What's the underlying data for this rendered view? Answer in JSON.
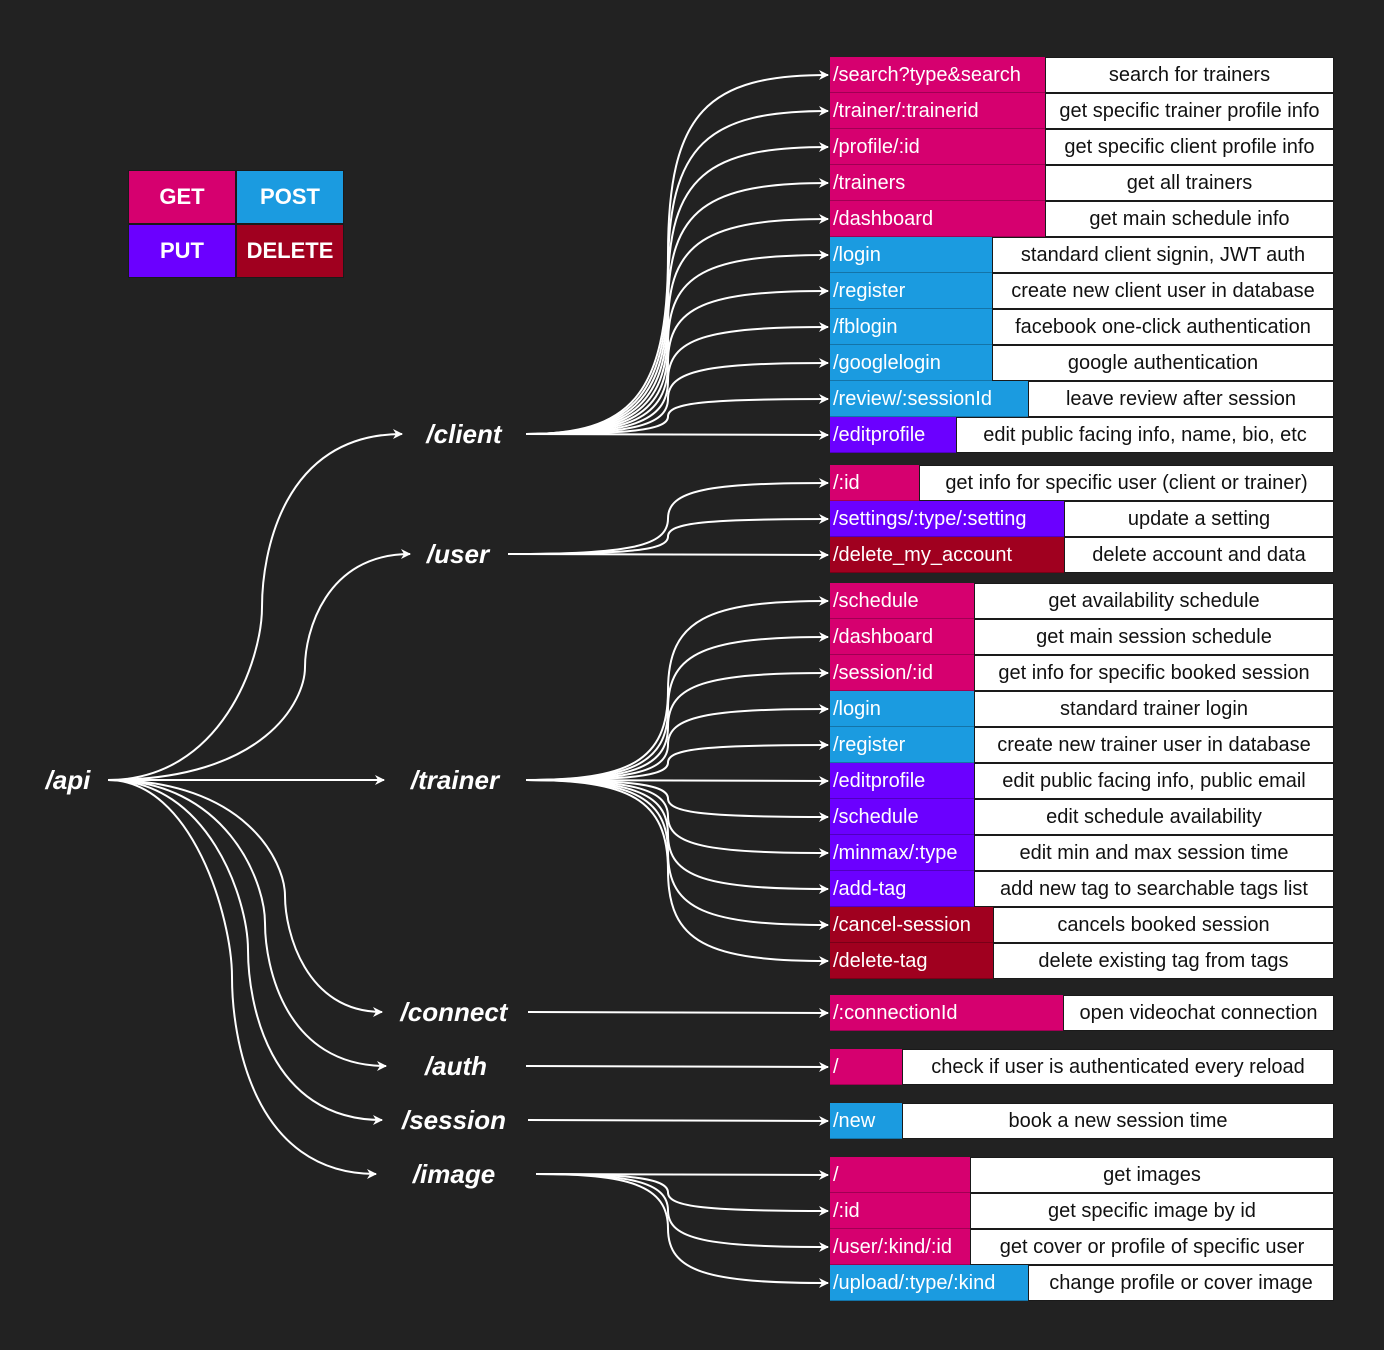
{
  "colors": {
    "GET": "#d6006f",
    "POST": "#1b9be0",
    "PUT": "#6b00ff",
    "DELETE": "#a0001f",
    "background": "#222222",
    "wire": "#ffffff"
  },
  "legend": [
    {
      "method": "GET",
      "label": "GET"
    },
    {
      "method": "POST",
      "label": "POST"
    },
    {
      "method": "PUT",
      "label": "PUT"
    },
    {
      "method": "DELETE",
      "label": "DELETE"
    }
  ],
  "root": {
    "label": "/api"
  },
  "groups": [
    {
      "name": "client",
      "label": "/client",
      "routes": [
        {
          "path": "/search?type&search",
          "method": "GET",
          "desc": "search for trainers"
        },
        {
          "path": "/trainer/:trainerid",
          "method": "GET",
          "desc": "get specific trainer profile info"
        },
        {
          "path": "/profile/:id",
          "method": "GET",
          "desc": "get specific client profile info"
        },
        {
          "path": "/trainers",
          "method": "GET",
          "desc": "get all trainers"
        },
        {
          "path": "/dashboard",
          "method": "GET",
          "desc": "get main schedule info"
        },
        {
          "path": "/login",
          "method": "POST",
          "desc": "standard client signin, JWT auth"
        },
        {
          "path": "/register",
          "method": "POST",
          "desc": "create new client user in database"
        },
        {
          "path": "/fblogin",
          "method": "POST",
          "desc": "facebook one-click authentication"
        },
        {
          "path": "/googlelogin",
          "method": "POST",
          "desc": "google authentication"
        },
        {
          "path": "/review/:sessionId",
          "method": "POST",
          "desc": "leave review after session"
        },
        {
          "path": "/editprofile",
          "method": "PUT",
          "desc": "edit public facing info, name, bio, etc"
        }
      ]
    },
    {
      "name": "user",
      "label": "/user",
      "routes": [
        {
          "path": "/:id",
          "method": "GET",
          "desc": "get info for specific user (client or trainer)"
        },
        {
          "path": "/settings/:type/:setting",
          "method": "PUT",
          "desc": "update a setting"
        },
        {
          "path": "/delete_my_account",
          "method": "DELETE",
          "desc": "delete account and data"
        }
      ]
    },
    {
      "name": "trainer",
      "label": "/trainer",
      "routes": [
        {
          "path": "/schedule",
          "method": "GET",
          "desc": "get availability schedule"
        },
        {
          "path": "/dashboard",
          "method": "GET",
          "desc": "get main session schedule"
        },
        {
          "path": "/session/:id",
          "method": "GET",
          "desc": "get info for specific booked session"
        },
        {
          "path": "/login",
          "method": "POST",
          "desc": "standard trainer login"
        },
        {
          "path": "/register",
          "method": "POST",
          "desc": "create new trainer user in database"
        },
        {
          "path": "/editprofile",
          "method": "PUT",
          "desc": "edit public facing info, public email"
        },
        {
          "path": "/schedule",
          "method": "PUT",
          "desc": "edit schedule availability"
        },
        {
          "path": "/minmax/:type",
          "method": "PUT",
          "desc": "edit min and max session time"
        },
        {
          "path": "/add-tag",
          "method": "PUT",
          "desc": "add new tag to searchable tags list"
        },
        {
          "path": "/cancel-session",
          "method": "DELETE",
          "desc": "cancels booked session"
        },
        {
          "path": "/delete-tag",
          "method": "DELETE",
          "desc": "delete existing tag from tags"
        }
      ]
    },
    {
      "name": "connect",
      "label": "/connect",
      "routes": [
        {
          "path": "/:connectionId",
          "method": "GET",
          "desc": "open videochat connection"
        }
      ]
    },
    {
      "name": "auth",
      "label": "/auth",
      "routes": [
        {
          "path": "/",
          "method": "GET",
          "desc": "check if user is authenticated every reload"
        }
      ]
    },
    {
      "name": "session",
      "label": "/session",
      "routes": [
        {
          "path": "/new",
          "method": "POST",
          "desc": "book a new session time"
        }
      ]
    },
    {
      "name": "image",
      "label": "/image",
      "routes": [
        {
          "path": "/",
          "method": "GET",
          "desc": "get images"
        },
        {
          "path": "/:id",
          "method": "GET",
          "desc": "get specific image by id"
        },
        {
          "path": "/user/:kind/:id",
          "method": "GET",
          "desc": "get cover or profile of specific user"
        },
        {
          "path": "/upload/:type/:kind",
          "method": "POST",
          "desc": "change profile or cover image"
        }
      ]
    }
  ]
}
